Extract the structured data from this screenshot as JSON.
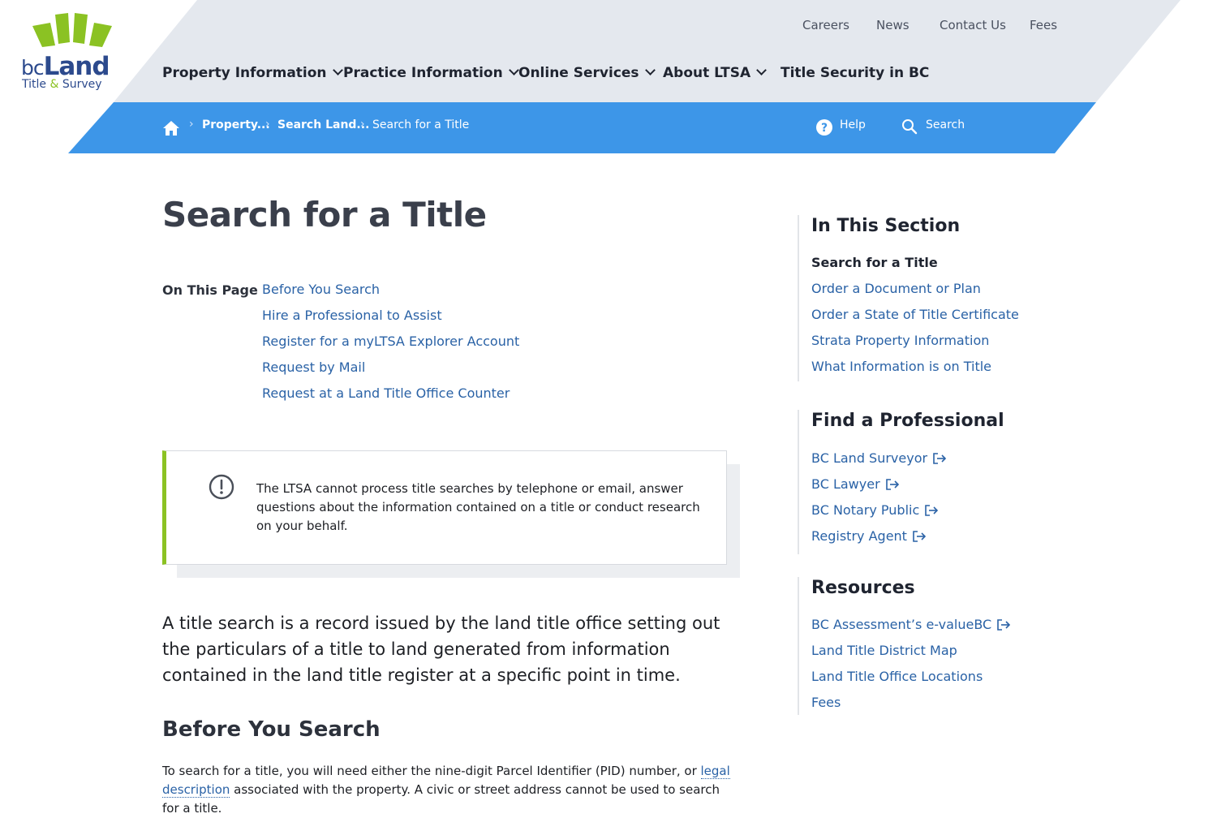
{
  "logo": {
    "bc": "bc",
    "land": "Land",
    "title": "Title",
    "amp": "&",
    "survey": "Survey"
  },
  "utility_nav": [
    "Careers",
    "News",
    "Contact Us",
    "Fees"
  ],
  "main_nav": [
    {
      "label": "Property Information",
      "has_dropdown": true
    },
    {
      "label": "Practice Information",
      "has_dropdown": true
    },
    {
      "label": "Online Services",
      "has_dropdown": true
    },
    {
      "label": "About LTSA",
      "has_dropdown": true
    },
    {
      "label": "Title Security in BC",
      "has_dropdown": false
    }
  ],
  "breadcrumb": [
    "Property...",
    "Search Land...",
    "Search for a Title"
  ],
  "breadcrumb_separator": "›",
  "actions": {
    "help": "Help",
    "search": "Search"
  },
  "page": {
    "title": "Search for a Title",
    "on_this_page_label": "On This Page",
    "on_this_page": [
      "Before You Search",
      "Hire a Professional to Assist",
      "Register for a myLTSA Explorer Account",
      "Request by Mail",
      "Request at a Land Title Office Counter"
    ],
    "notice": "The LTSA cannot process title searches by telephone or email, answer questions about the information contained on a title or conduct research on your behalf.",
    "lead": "A title search is a record issued by the land title office setting out the particulars of a title to land generated from information contained in the land title register at a specific point in time.",
    "section_heading": "Before You Search",
    "para_before": "To search for a title, you will need either the nine-digit Parcel Identifier (PID) number, or ",
    "para_link": "legal description",
    "para_after": " associated with the property. A civic or street address cannot be used to search for a title."
  },
  "sidebar": {
    "in_this_section": {
      "heading": "In This Section",
      "items": [
        "Search for a Title",
        "Order a Document or Plan",
        "Order a State of Title Certificate",
        "Strata Property Information",
        "What Information is on Title"
      ]
    },
    "find_professional": {
      "heading": "Find a Professional",
      "items": [
        "BC Land Surveyor",
        "BC Lawyer",
        "BC Notary Public",
        "Registry Agent"
      ]
    },
    "resources": {
      "heading": "Resources",
      "items": [
        "BC Assessment’s e-valueBC",
        "Land Title District Map",
        "Land Title Office Locations",
        "Fees"
      ]
    }
  },
  "colors": {
    "brand_blue": "#3d96e8",
    "header_grey": "#e4e8ee",
    "accent_green": "#8bc223",
    "link": "#2a62a6"
  },
  "icons": [
    "home-icon",
    "help-icon",
    "search-icon",
    "alert-icon",
    "external-link-icon",
    "chevron-down-icon"
  ]
}
